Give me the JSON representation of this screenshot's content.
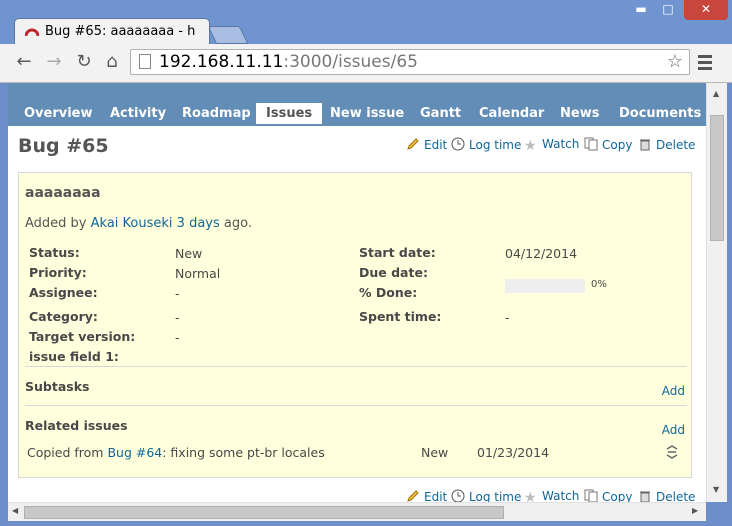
{
  "browser": {
    "tab_title": "Bug #65: aaaaaaaa - h",
    "url_host": "192.168.11.11",
    "url_rest": ":3000/issues/65"
  },
  "icons": [
    "redmine-favicon",
    "back-arrow-icon",
    "forward-arrow-icon",
    "reload-icon",
    "home-icon",
    "page-icon",
    "bookmark-star-icon",
    "chrome-menu-icon",
    "edit-icon",
    "log-time-icon",
    "watch-star-icon",
    "copy-icon",
    "delete-icon",
    "related-delete-icon"
  ],
  "menu": {
    "overview": "Overview",
    "activity": "Activity",
    "roadmap": "Roadmap",
    "issues": "Issues",
    "new_issue": "New issue",
    "gantt": "Gantt",
    "calendar": "Calendar",
    "news": "News",
    "documents": "Documents"
  },
  "page_title": "Bug #65",
  "actions": {
    "edit": "Edit",
    "log_time": "Log time",
    "watch": "Watch",
    "copy": "Copy",
    "delete": "Delete"
  },
  "issue": {
    "subject": "aaaaaaaa",
    "added_by_prefix": "Added by ",
    "author": "Akai Kouseki",
    "time_ago": "3 days",
    "added_by_suffix": " ago.",
    "status_label": "Status:",
    "status": "New",
    "priority_label": "Priority:",
    "priority": "Normal",
    "assignee_label": "Assignee:",
    "assignee": "-",
    "category_label": "Category:",
    "category": "-",
    "target_version_label": "Target version:",
    "target_version": "-",
    "custom_field_label": "issue field 1:",
    "start_date_label": "Start date:",
    "start_date": "04/12/2014",
    "due_date_label": "Due date:",
    "done_label": "% Done:",
    "done_percent": 0,
    "done_text": "0%",
    "spent_time_label": "Spent time:",
    "spent_time": "-"
  },
  "subtasks": {
    "title": "Subtasks",
    "add": "Add"
  },
  "related": {
    "title": "Related issues",
    "add": "Add",
    "relation": "Copied from ",
    "issue_link": "Bug #64",
    "issue_subject": ": fixing some pt-br locales",
    "status": "New",
    "date": "01/23/2014"
  },
  "colors": {
    "header_blue": "#628db6",
    "issue_background": "#ffffdd",
    "link": "#116699"
  }
}
